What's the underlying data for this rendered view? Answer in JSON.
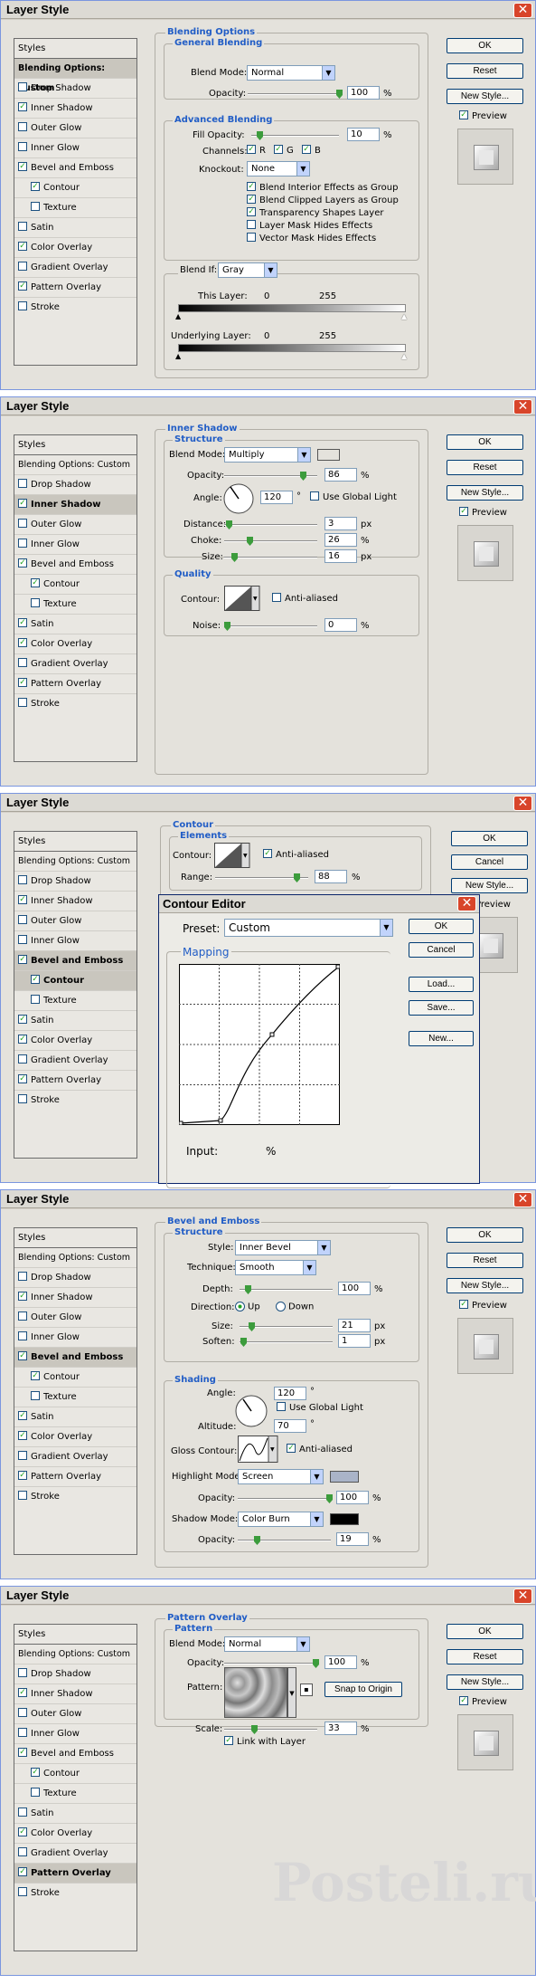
{
  "window_title": "Layer Style",
  "buttons": {
    "ok": "OK",
    "reset": "Reset",
    "cancel": "Cancel",
    "new_style": "New Style...",
    "preview": "Preview"
  },
  "styles": {
    "header": "Styles",
    "items": [
      "Blending Options: Custom",
      "Drop Shadow",
      "Inner Shadow",
      "Outer Glow",
      "Inner Glow",
      "Bevel and Emboss",
      "Contour",
      "Texture",
      "Satin",
      "Color Overlay",
      "Gradient Overlay",
      "Pattern Overlay",
      "Stroke"
    ]
  },
  "panel1": {
    "section": "Blending Options",
    "general": "General Blending",
    "blend_mode_lbl": "Blend Mode:",
    "blend_mode": "Normal",
    "opacity_lbl": "Opacity:",
    "opacity": "100",
    "pct": "%",
    "advanced": "Advanced Blending",
    "fill_lbl": "Fill Opacity:",
    "fill": "10",
    "channels_lbl": "Channels:",
    "ch_r": "R",
    "ch_g": "G",
    "ch_b": "B",
    "knockout_lbl": "Knockout:",
    "knockout": "None",
    "opts": [
      "Blend Interior Effects as Group",
      "Blend Clipped Layers as Group",
      "Transparency Shapes Layer",
      "Layer Mask Hides Effects",
      "Vector Mask Hides Effects"
    ],
    "blendif_lbl": "Blend If:",
    "blendif": "Gray",
    "this_layer": "This Layer:",
    "underlying": "Underlying Layer:",
    "v0": "0",
    "v255": "255"
  },
  "panel2": {
    "section": "Inner Shadow",
    "structure": "Structure",
    "blend_mode_lbl": "Blend Mode:",
    "blend_mode": "Multiply",
    "opacity_lbl": "Opacity:",
    "opacity": "86",
    "angle_lbl": "Angle:",
    "angle": "120",
    "deg": "°",
    "global": "Use Global Light",
    "distance_lbl": "Distance:",
    "distance": "3",
    "choke_lbl": "Choke:",
    "choke": "26",
    "size_lbl": "Size:",
    "size": "16",
    "px": "px",
    "pct": "%",
    "quality": "Quality",
    "contour_lbl": "Contour:",
    "aa": "Anti-aliased",
    "noise_lbl": "Noise:",
    "noise": "0",
    "shadow_color": "#636363"
  },
  "panel3": {
    "section": "Contour",
    "elements": "Elements",
    "contour_lbl": "Contour:",
    "aa": "Anti-aliased",
    "range_lbl": "Range:",
    "range": "88",
    "pct": "%",
    "editor_title": "Contour Editor",
    "preset_lbl": "Preset:",
    "preset": "Custom",
    "mapping": "Mapping",
    "load": "Load...",
    "save": "Save...",
    "new": "New...",
    "input_lbl": "Input:",
    "input_pct": "%"
  },
  "panel4": {
    "section": "Bevel and Emboss",
    "structure": "Structure",
    "style_lbl": "Style:",
    "style": "Inner Bevel",
    "technique_lbl": "Technique:",
    "technique": "Smooth",
    "depth_lbl": "Depth:",
    "depth": "100",
    "pct": "%",
    "direction_lbl": "Direction:",
    "up": "Up",
    "down": "Down",
    "size_lbl": "Size:",
    "size": "21",
    "soften_lbl": "Soften:",
    "soften": "1",
    "px": "px",
    "shading": "Shading",
    "angle_lbl": "Angle:",
    "angle": "120",
    "deg": "°",
    "global": "Use Global Light",
    "altitude_lbl": "Altitude:",
    "altitude": "70",
    "gloss_lbl": "Gloss Contour:",
    "aa": "Anti-aliased",
    "highlight_lbl": "Highlight Mode:",
    "highlight": "Screen",
    "h_opacity_lbl": "Opacity:",
    "h_opacity": "100",
    "shadow_lbl": "Shadow Mode:",
    "shadow": "Color Burn",
    "s_opacity_lbl": "Opacity:",
    "s_opacity": "19",
    "highlight_color": "#aab4c8",
    "shadow_color": "#000000"
  },
  "panel5": {
    "section": "Pattern Overlay",
    "pattern_title": "Pattern",
    "blend_mode_lbl": "Blend Mode:",
    "blend_mode": "Normal",
    "opacity_lbl": "Opacity:",
    "opacity": "100",
    "pct": "%",
    "pattern_lbl": "Pattern:",
    "snap": "Snap to Origin",
    "scale_lbl": "Scale:",
    "scale": "33",
    "link": "Link with Layer"
  },
  "logo": "Posteli.ru"
}
